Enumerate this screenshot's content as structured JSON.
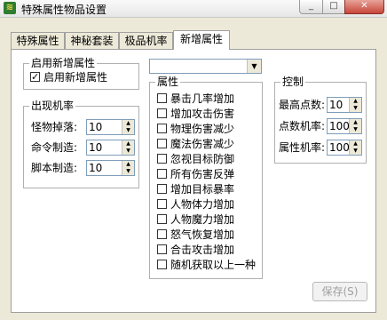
{
  "window": {
    "title": "特殊属性物品设置"
  },
  "tabs": [
    {
      "label": "特殊属性"
    },
    {
      "label": "神秘套装"
    },
    {
      "label": "极品机率"
    },
    {
      "label": "新增属性"
    }
  ],
  "enable_group": {
    "title": "启用新增属性",
    "checkbox_label": "启用新增属性",
    "checked": true
  },
  "appear_group": {
    "title": "出现机率",
    "rows": [
      {
        "label": "怪物掉落:",
        "value": "10"
      },
      {
        "label": "命令制造:",
        "value": "10"
      },
      {
        "label": "脚本制造:",
        "value": "10"
      }
    ]
  },
  "attr_dropdown": {
    "value": ""
  },
  "attr_group": {
    "title": "属性",
    "items": [
      {
        "label": "暴击几率增加",
        "checked": false
      },
      {
        "label": "增加攻击伤害",
        "checked": false
      },
      {
        "label": "物理伤害减少",
        "checked": false
      },
      {
        "label": "魔法伤害减少",
        "checked": false
      },
      {
        "label": "忽视目标防御",
        "checked": false
      },
      {
        "label": "所有伤害反弹",
        "checked": false
      },
      {
        "label": "增加目标暴率",
        "checked": false
      },
      {
        "label": "人物体力增加",
        "checked": false
      },
      {
        "label": "人物魔力增加",
        "checked": false
      },
      {
        "label": "怒气恢复增加",
        "checked": false
      },
      {
        "label": "合击攻击增加",
        "checked": false
      },
      {
        "label": "随机获取以上一种",
        "checked": false
      }
    ]
  },
  "control_group": {
    "title": "控制",
    "rows": [
      {
        "label": "最高点数:",
        "value": "10"
      },
      {
        "label": "点数机率:",
        "value": "100"
      },
      {
        "label": "属性机率:",
        "value": "100"
      }
    ]
  },
  "save_button": {
    "label": "保存(S)"
  },
  "window_buttons": {
    "minimize": "_",
    "maximize": "□",
    "close": "✕"
  }
}
